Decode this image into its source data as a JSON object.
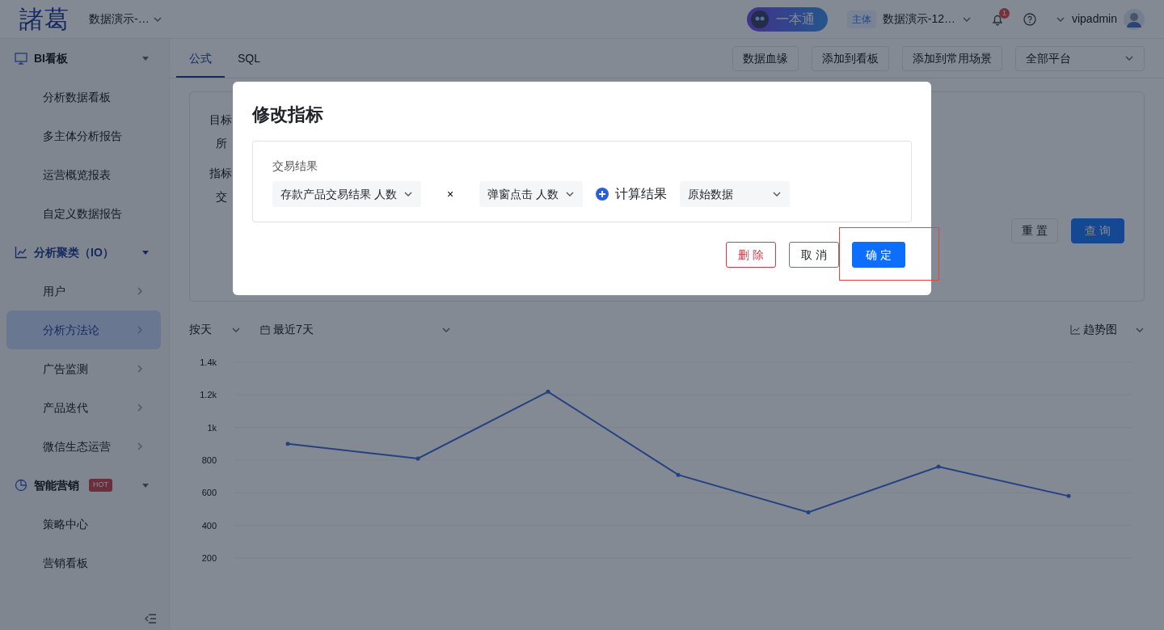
{
  "header": {
    "logo": "諸葛",
    "project": "数据演示-…",
    "assistant": "一本通",
    "subject_tag": "主体",
    "subject": "数据演示-12…",
    "notification_count": "1",
    "user": "vipadmin"
  },
  "sidebar": {
    "sections": [
      {
        "label": "BI看板",
        "active": false,
        "expanded": true,
        "children": [
          {
            "label": "分析数据看板",
            "kind": "link",
            "selected": false
          },
          {
            "label": "多主体分析报告",
            "kind": "link",
            "selected": false
          },
          {
            "label": "运营概览报表",
            "kind": "link",
            "selected": false
          },
          {
            "label": "自定义数据报告",
            "kind": "link",
            "selected": false
          }
        ]
      },
      {
        "label": "分析聚类（IO）",
        "active": true,
        "expanded": true,
        "children": [
          {
            "label": "用户",
            "kind": "submenu",
            "selected": false
          },
          {
            "label": "分析方法论",
            "kind": "submenu",
            "selected": true
          },
          {
            "label": "广告监测",
            "kind": "submenu",
            "selected": false
          },
          {
            "label": "产品迭代",
            "kind": "submenu",
            "selected": false
          },
          {
            "label": "微信生态运营",
            "kind": "submenu",
            "selected": false
          }
        ]
      },
      {
        "label": "智能营销",
        "badge": "HOT",
        "active": false,
        "expanded": true,
        "children": [
          {
            "label": "策略中心",
            "kind": "link",
            "selected": false
          },
          {
            "label": "营销看板",
            "kind": "link",
            "selected": false
          }
        ]
      }
    ]
  },
  "content": {
    "tabs": [
      {
        "label": "公式",
        "selected": true
      },
      {
        "label": "SQL",
        "selected": false
      }
    ],
    "actions": [
      "数据血缘",
      "添加到看板",
      "添加到常用场景"
    ],
    "platform": "全部平台",
    "form": {
      "target_label": "目标",
      "target_value": "所",
      "metric_label": "指标",
      "metric_value": "交",
      "reset": "重 置",
      "query": "查 询"
    },
    "toolbar": {
      "granularity": "按天",
      "date_range": "最近7天",
      "chart_type": "趋势图"
    },
    "chart_data": {
      "type": "line",
      "grid": true,
      "categories": [
        null,
        null,
        null,
        null,
        null,
        null,
        null
      ],
      "values": [
        900,
        810,
        1220,
        710,
        480,
        760,
        580
      ],
      "ylim": [
        200,
        1400
      ],
      "yticks": [
        {
          "value": 200,
          "label": "200"
        },
        {
          "value": 400,
          "label": "400"
        },
        {
          "value": 600,
          "label": "600"
        },
        {
          "value": 800,
          "label": "800"
        },
        {
          "value": 1000,
          "label": "1k"
        },
        {
          "value": 1200,
          "label": "1.2k"
        },
        {
          "value": 1400,
          "label": "1.4k"
        }
      ]
    }
  },
  "modal": {
    "title": "修改指标",
    "group_label": "交易结果",
    "formula": [
      {
        "kind": "select",
        "value": "存款产品交易结果 人数"
      },
      {
        "kind": "operator",
        "value": "×"
      },
      {
        "kind": "select",
        "value": "弹窗点击 人数"
      },
      {
        "kind": "add",
        "value": "计算结果"
      },
      {
        "kind": "dropdown",
        "value": "原始数据"
      }
    ],
    "buttons": [
      {
        "label": "删 除",
        "kind": "danger",
        "highlighted": false
      },
      {
        "label": "取 消",
        "kind": "default",
        "highlighted": false
      },
      {
        "label": "确 定",
        "kind": "primary",
        "highlighted": true
      }
    ]
  }
}
